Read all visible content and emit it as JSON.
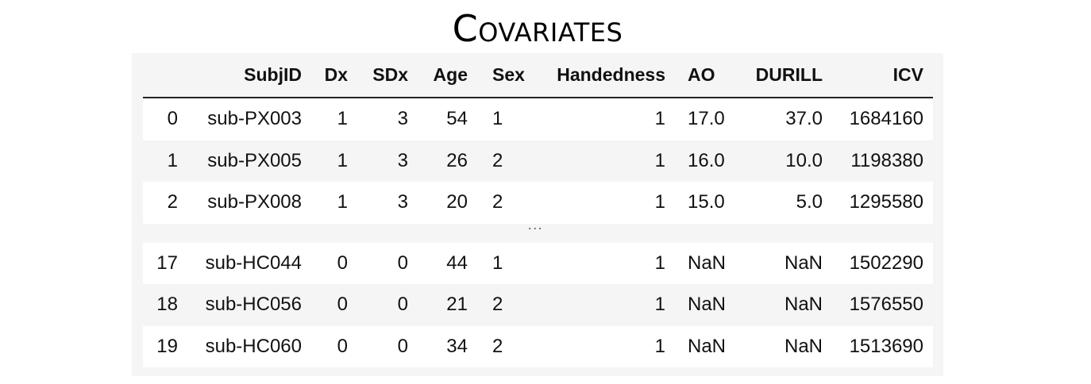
{
  "title": "Covariates",
  "table": {
    "columns": [
      "",
      "SubjID",
      "Dx",
      "SDx",
      "Age",
      "Sex",
      "Handedness",
      "AO",
      "DURILL",
      "ICV"
    ],
    "rows_top": [
      [
        "0",
        "sub-PX003",
        "1",
        "3",
        "54",
        "1",
        "1",
        "17.0",
        "37.0",
        "1684160"
      ],
      [
        "1",
        "sub-PX005",
        "1",
        "3",
        "26",
        "2",
        "1",
        "16.0",
        "10.0",
        "1198380"
      ],
      [
        "2",
        "sub-PX008",
        "1",
        "3",
        "20",
        "2",
        "1",
        "15.0",
        "5.0",
        "1295580"
      ]
    ],
    "ellipsis": "...",
    "rows_bottom": [
      [
        "17",
        "sub-HC044",
        "0",
        "0",
        "44",
        "1",
        "1",
        "NaN",
        "NaN",
        "1502290"
      ],
      [
        "18",
        "sub-HC056",
        "0",
        "0",
        "21",
        "2",
        "1",
        "NaN",
        "NaN",
        "1576550"
      ],
      [
        "19",
        "sub-HC060",
        "0",
        "0",
        "34",
        "2",
        "1",
        "NaN",
        "NaN",
        "1513690"
      ]
    ]
  }
}
